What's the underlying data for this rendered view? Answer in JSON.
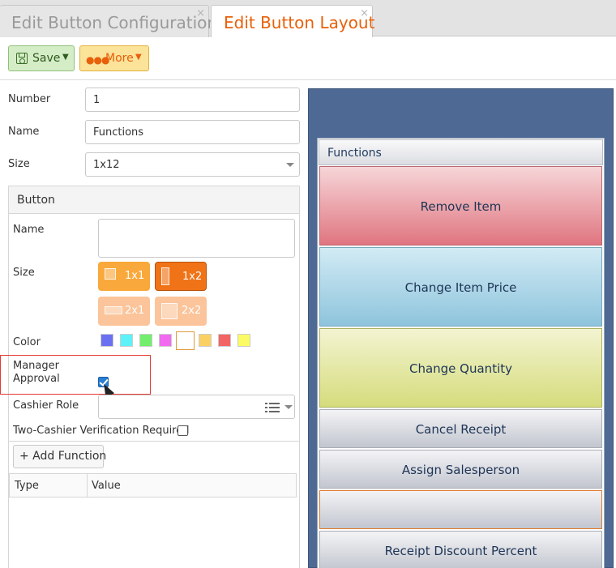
{
  "tabs": [
    {
      "label": "Edit Button Configuration",
      "close": "×"
    },
    {
      "label": "Edit Button Layout",
      "close": "×"
    }
  ],
  "toolbar": {
    "save_label": "Save",
    "save_icon": "save-icon",
    "more_label": "More",
    "more_icon": "ellipsis-icon",
    "caret": "▼"
  },
  "form": {
    "number_label": "Number",
    "number_value": "1",
    "name_label": "Name",
    "name_value": "Functions",
    "size_label": "Size",
    "size_value": "1x12"
  },
  "button_panel": {
    "title": "Button",
    "name_label": "Name",
    "name_value": "",
    "size_label": "Size",
    "sizes": [
      "1x1",
      "1x2",
      "2x1",
      "2x2"
    ],
    "selected_size": "1x2",
    "color_label": "Color",
    "colors": [
      "#6b6ff2",
      "#5df2f7",
      "#72ee6c",
      "#f26af0",
      "#ffffff",
      "#fbd063",
      "#f36464",
      "#fbfb63"
    ],
    "selected_color": "#ffffff",
    "manager_label_line1": "Manager",
    "manager_label_line2": "Approval",
    "manager_approval": true,
    "cashier_role_label": "Cashier Role",
    "cashier_role_value": "",
    "two_cashier_label": "Two-Cashier Verification Required",
    "two_cashier": false,
    "add_function_label": "+ Add Function",
    "table_columns": [
      "Type",
      "Value"
    ],
    "table_rows": []
  },
  "preview": {
    "group_title": "Functions",
    "buttons": [
      {
        "label": "Remove Item",
        "style": "red"
      },
      {
        "label": "Change Item Price",
        "style": "blue"
      },
      {
        "label": "Change Quantity",
        "style": "yellow"
      },
      {
        "label": "Cancel Receipt",
        "style": "gray"
      },
      {
        "label": "Assign Salesperson",
        "style": "gray"
      },
      {
        "label": "",
        "style": "selected"
      },
      {
        "label": "Receipt Discount Percent",
        "style": "gray"
      }
    ]
  }
}
